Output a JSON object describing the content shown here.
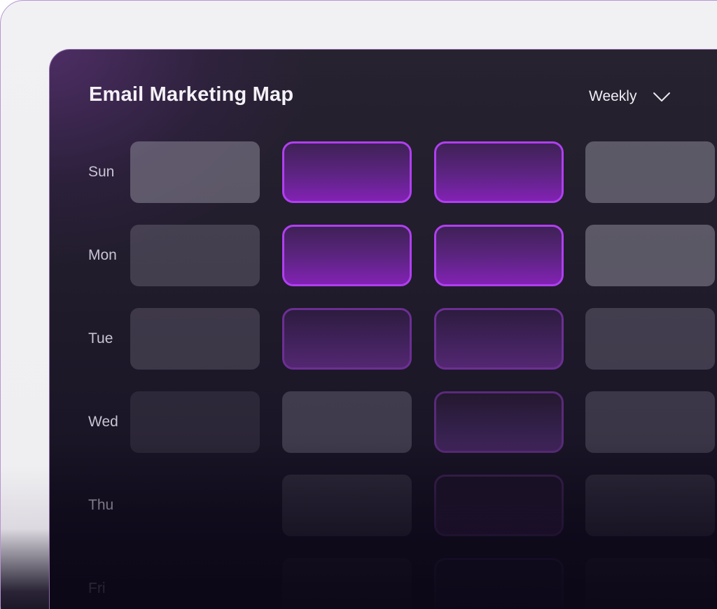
{
  "widget": {
    "title": "Email Marketing Map",
    "period": {
      "selected": "Weekly",
      "icon": "chevron-down-icon"
    }
  },
  "colors": {
    "accent": "#b03ff0",
    "panel_background": "#211d2c",
    "inactive_cell": "#4a4656"
  },
  "schedule": {
    "rows": [
      {
        "day": "Sun",
        "cells": [
          "inactive",
          "high",
          "high",
          "inactive"
        ]
      },
      {
        "day": "Mon",
        "cells": [
          "inactive",
          "high",
          "high",
          "inactive"
        ]
      },
      {
        "day": "Tue",
        "cells": [
          "inactive",
          "medium",
          "medium",
          "inactive"
        ]
      },
      {
        "day": "Wed",
        "cells": [
          "inactive",
          "inactive",
          "medium",
          "inactive"
        ]
      },
      {
        "day": "Thu",
        "cells": [
          "none",
          "inactive",
          "low",
          "inactive"
        ]
      },
      {
        "day": "Fri",
        "cells": [
          "none",
          "inactive",
          "low",
          "inactive"
        ]
      }
    ]
  }
}
